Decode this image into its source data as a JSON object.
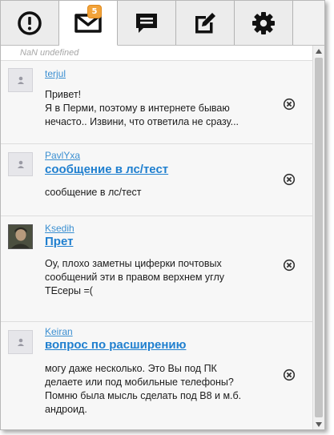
{
  "tabs": [
    {
      "name": "alerts",
      "icon": "exclamation-icon"
    },
    {
      "name": "messages",
      "icon": "envelope-icon",
      "badge": "5",
      "active": true
    },
    {
      "name": "chat",
      "icon": "chat-bubble-icon"
    },
    {
      "name": "compose",
      "icon": "edit-icon"
    },
    {
      "name": "settings",
      "icon": "gear-icon"
    }
  ],
  "status_line": "NaN undefined",
  "messages": [
    {
      "author": "terjul",
      "subject": "",
      "body_lines": [
        "Привет!",
        "Я в Перми, поэтому в интернете бываю",
        "нечасто.. Извини, что ответила не сразу..."
      ]
    },
    {
      "author": "PavlYxa",
      "subject": "сообщение в лс/тест",
      "body_lines": [
        "сообщение в лс/тест"
      ]
    },
    {
      "author": "Ksedih",
      "subject": "Прет",
      "body_lines": [
        "Оу, плохо заметны циферки почтовых",
        "сообщений эти в правом верхнем углу",
        "ТЕсеры =("
      ]
    },
    {
      "author": "Keiran",
      "subject": "вопрос по расширению",
      "body_lines": [
        "могу даже несколько. Это Вы под ПК",
        "делаете или под мобильные телефоны?",
        "Помню была мысль сделать под B8 и м.б.",
        "андроид."
      ]
    }
  ],
  "colors": {
    "accent_link": "#1f7fcf",
    "badge": "#f2a33a",
    "background": "#f7f7f7"
  }
}
